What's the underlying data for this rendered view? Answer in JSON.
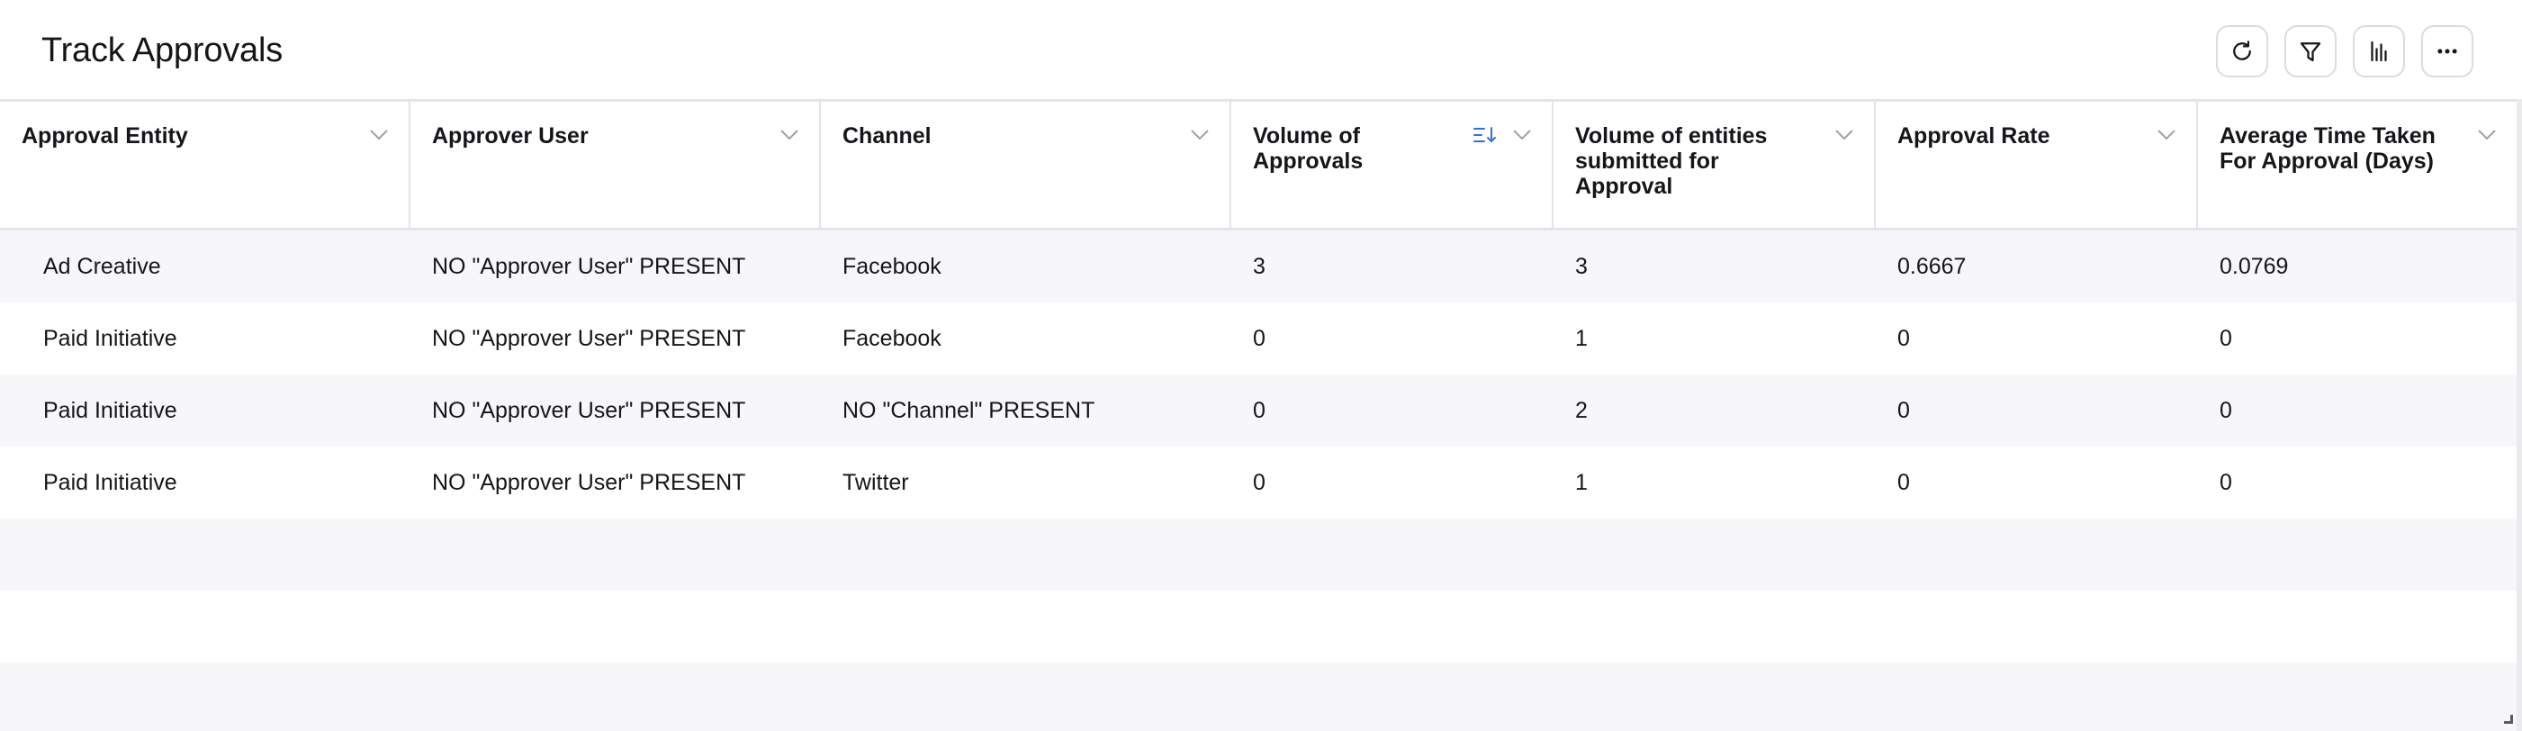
{
  "widget": {
    "title": "Track Approvals",
    "toolbar": [
      {
        "name": "refresh",
        "icon": "refresh-icon"
      },
      {
        "name": "filter",
        "icon": "filter-icon"
      },
      {
        "name": "chart",
        "icon": "bar-chart-icon"
      },
      {
        "name": "more",
        "icon": "more-horizontal-icon"
      }
    ]
  },
  "table": {
    "columns": [
      {
        "label": "Approval Entity",
        "sorted": false
      },
      {
        "label": "Approver User",
        "sorted": false
      },
      {
        "label": "Channel",
        "sorted": false
      },
      {
        "label": "Volume of Approvals",
        "sorted": true,
        "sort_direction": "descending"
      },
      {
        "label": "Volume of entities submitted for Approval",
        "sorted": false
      },
      {
        "label": "Approval Rate",
        "sorted": false
      },
      {
        "label": "Average Time Taken For Approval (Days)",
        "sorted": false
      }
    ],
    "rows": [
      [
        "Ad Creative",
        "NO \"Approver User\" PRESENT",
        "Facebook",
        "3",
        "3",
        "0.6667",
        "0.0769"
      ],
      [
        "Paid Initiative",
        "NO \"Approver User\" PRESENT",
        "Facebook",
        "0",
        "1",
        "0",
        "0"
      ],
      [
        "Paid Initiative",
        "NO \"Approver User\" PRESENT",
        "NO \"Channel\" PRESENT",
        "0",
        "2",
        "0",
        "0"
      ],
      [
        "Paid Initiative",
        "NO \"Approver User\" PRESENT",
        "Twitter",
        "0",
        "1",
        "0",
        "0"
      ]
    ]
  },
  "colors": {
    "sort_accent": "#2f6fed",
    "chevron": "#a0a0a8",
    "row_alt": "#f7f7f9",
    "border": "#e4e4e7"
  }
}
